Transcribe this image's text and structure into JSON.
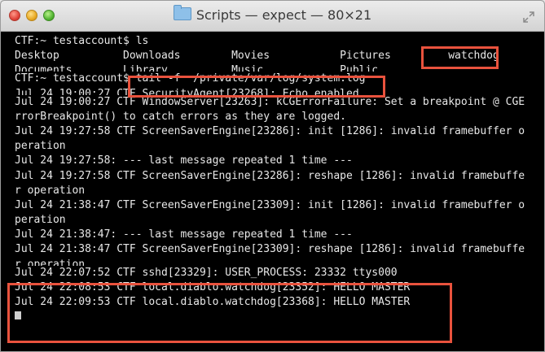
{
  "window": {
    "title": "Scripts — expect — 80×21",
    "folder_icon": "folder-icon",
    "resize_icon": "fullscreen-icon"
  },
  "terminal": {
    "lines": [
      "CTF:~ testaccount$ ls",
      "Desktop          Downloads        Movies           Pictures         watchdog",
      "Documents        Library          Music            Public",
      "CTF:~ testaccount$ tail -f  /private/var/log/system.log",
      "Jul 24 19:00:27 CTF SecurityAgent[23268]: Echo enabled",
      "Jul 24 19:00:27 CTF WindowServer[23263]: kCGErrorFailure: Set a breakpoint @ CGE",
      "rrorBreakpoint() to catch errors as they are logged.",
      "Jul 24 19:27:58 CTF ScreenSaverEngine[23286]: init [1286]: invalid framebuffer o",
      "peration",
      "Jul 24 19:27:58: --- last message repeated 1 time ---",
      "Jul 24 19:27:58 CTF ScreenSaverEngine[23286]: reshape [1286]: invalid framebuffe",
      "r operation",
      "Jul 24 21:38:47 CTF ScreenSaverEngine[23309]: init [1286]: invalid framebuffer o",
      "peration",
      "Jul 24 21:38:47: --- last message repeated 1 time ---",
      "Jul 24 21:38:47 CTF ScreenSaverEngine[23309]: reshape [1286]: invalid framebuffe",
      "r operation",
      "Jul 24 22:07:52 CTF sshd[23329]: USER_PROCESS: 23332 ttys000",
      "Jul 24 22:08:53 CTF local.diablo.watchdog[23352]: HELLO MASTER",
      "Jul 24 22:09:53 CTF local.diablo.watchdog[23368]: HELLO MASTER"
    ]
  },
  "colors": {
    "highlight": "#e9523d",
    "terminal_bg": "#000000",
    "terminal_fg": "#e8e8e8"
  }
}
